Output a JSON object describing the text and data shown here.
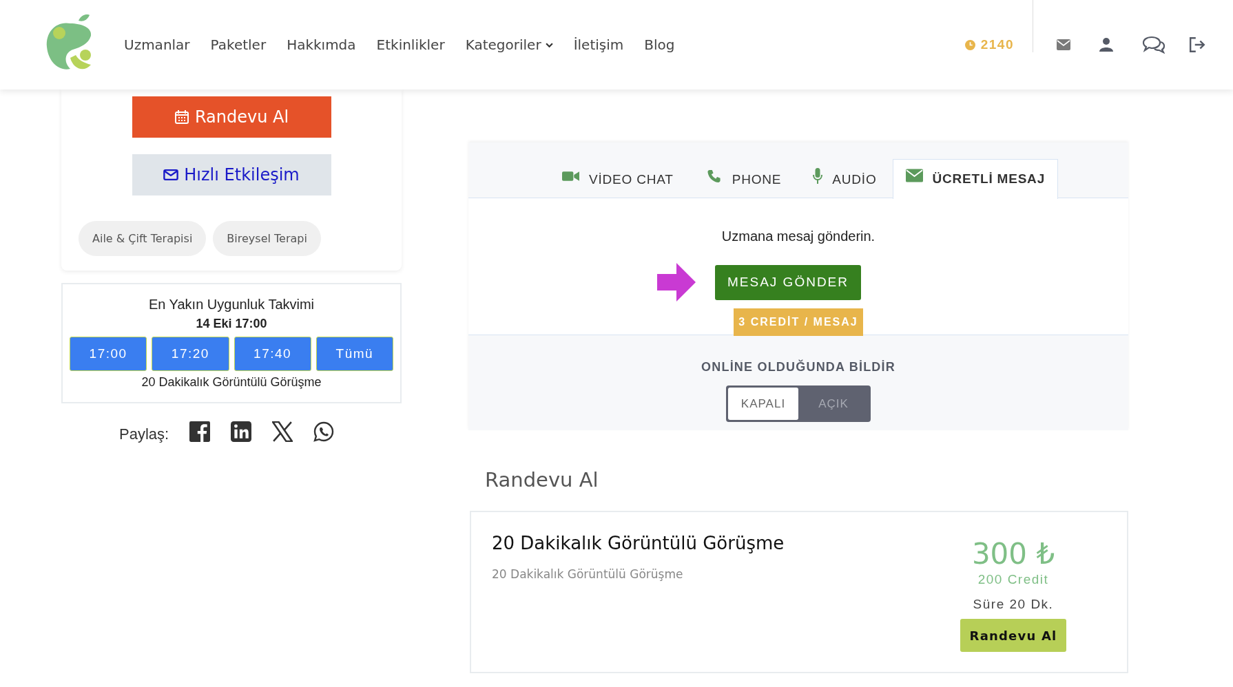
{
  "nav": {
    "items": [
      {
        "label": "Uzmanlar",
        "dropdown": false
      },
      {
        "label": "Paketler",
        "dropdown": false
      },
      {
        "label": "Hakkımda",
        "dropdown": false
      },
      {
        "label": "Etkinlikler",
        "dropdown": false
      },
      {
        "label": "Kategoriler",
        "dropdown": true
      },
      {
        "label": "İletişim",
        "dropdown": false
      },
      {
        "label": "Blog",
        "dropdown": false
      }
    ],
    "credits": "2140"
  },
  "profile": {
    "book_button": "Randevu Al",
    "quick_button": "Hızlı Etkileşim",
    "tags": [
      "Aile & Çift Terapisi",
      "Bireysel Terapi"
    ]
  },
  "availability": {
    "title": "En Yakın Uygunluk Takvimi",
    "date": "14 Eki 17:00",
    "slots": [
      "17:00",
      "17:20",
      "17:40",
      "Tümü"
    ],
    "session": "20 Dakikalık Görüntülü Görüşme"
  },
  "share": {
    "label": "Paylaş:"
  },
  "contact": {
    "tabs": [
      {
        "label": "VİDEO CHAT",
        "selected": false
      },
      {
        "label": "PHONE",
        "selected": false
      },
      {
        "label": "AUDİO",
        "selected": false
      },
      {
        "label": "ÜCRETLİ MESAJ",
        "selected": true
      }
    ],
    "prompt": "Uzmana mesaj gönderin.",
    "send_button": "MESAJ GÖNDER",
    "price_badge": "3 CREDİT / MESAJ",
    "notify_title": "ONLİNE OLDUĞUNDA BİLDİR",
    "notify_options": [
      {
        "label": "KAPALI",
        "selected": true
      },
      {
        "label": "AÇIK",
        "selected": false
      }
    ]
  },
  "booking": {
    "heading": "Randevu Al",
    "packages": [
      {
        "title": "20 Dakikalık Görüntülü Görüşme",
        "description": "20 Dakikalık Görüntülü Görüşme",
        "price": "300 ₺",
        "credit": "200 Credit",
        "duration": "Süre 20 Dk.",
        "button": "Randevu Al"
      }
    ]
  }
}
